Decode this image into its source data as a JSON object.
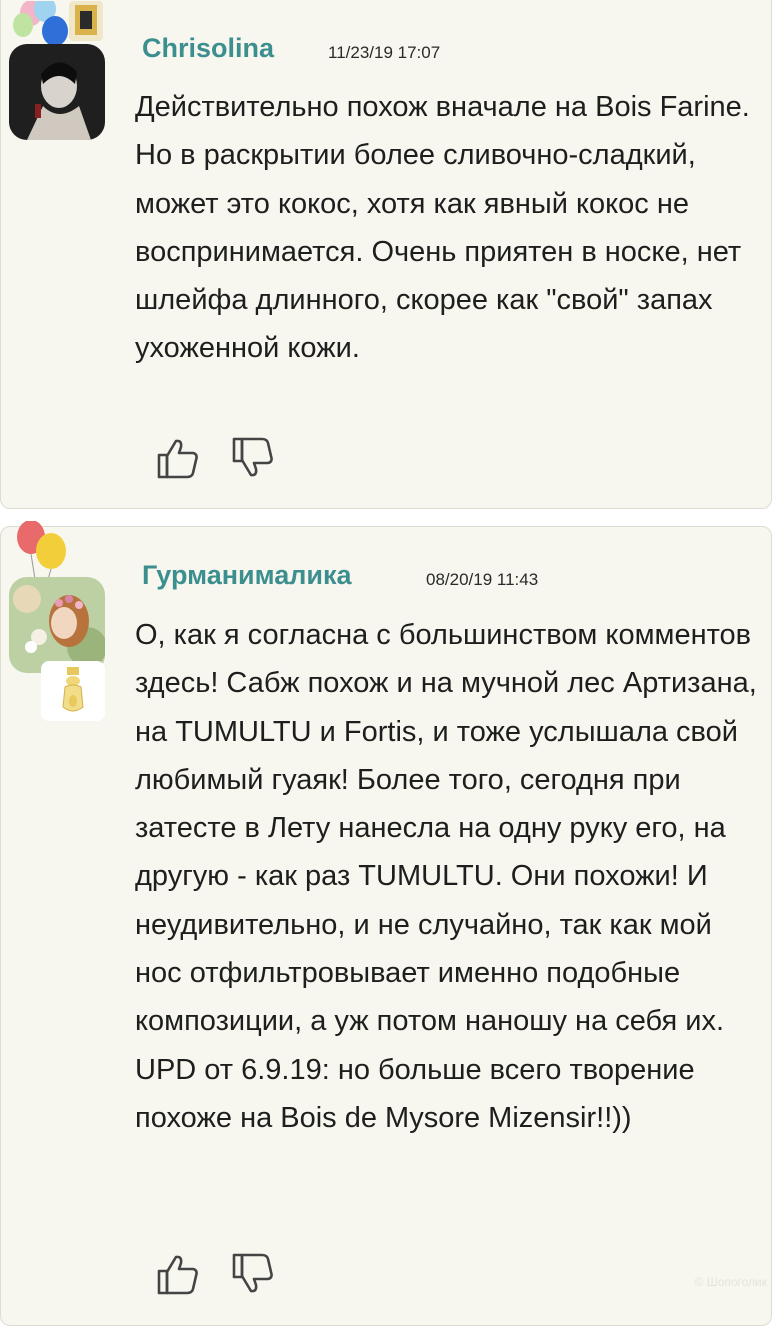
{
  "comments": [
    {
      "author": "Chrisolina",
      "date": "11/23/19 17:07",
      "paragraphs": [
        "Действительно похож вначале на Bois Farine. Но в раскрытии более сливочно-сладкий, может это кокос, хотя как явный кокос не воспринимается. Очень приятен в носке, нет шлейфа длинного, скорее как \"свой\" запах ухоженной кожи."
      ]
    },
    {
      "author": "Гурманималика",
      "date": "08/20/19 11:43",
      "paragraphs": [
        "О, как я согласна с большинством комментов здесь! Сабж похож и на мучной лес Артизана, на TUMULTU и Fortis, и тоже услышала свой любимый гуаяк! Более того, сегодня при затесте в Лету нанесла на одну руку его, на другую - как раз TUMULTU. Они похожи! И неудивительно, и не случайно, так как мой нос отфильтровывает именно подобные композиции, а уж потом наношу на себя их.",
        "UPD от 6.9.19: но больше всего творение похоже на Bois de Mysore Mizensir!!))"
      ]
    }
  ],
  "watermark": "© Шопоголик",
  "icons": {
    "like": "thumbs-up-icon",
    "dislike": "thumbs-down-icon"
  },
  "colors": {
    "author": "#3d8f8f",
    "card_background": "#f7f7ef",
    "card_border": "#dcdcd2"
  }
}
